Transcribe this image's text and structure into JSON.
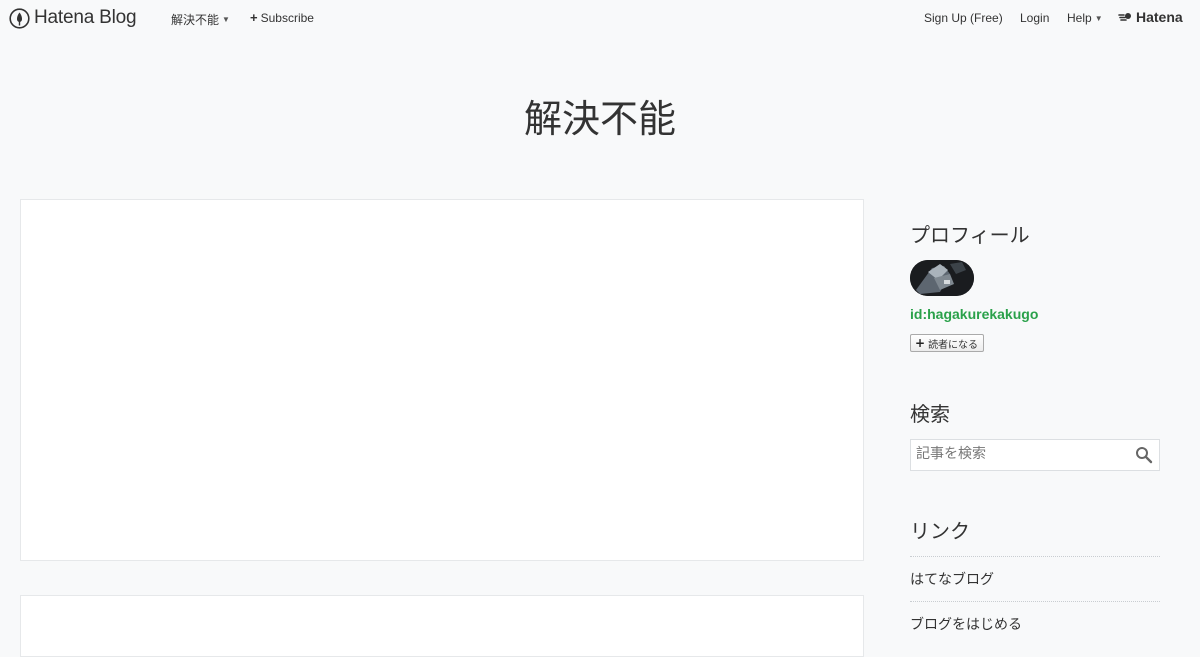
{
  "topbar": {
    "brand_text": "Hatena Blog",
    "blog_menu_label": "解決不能",
    "subscribe_label": "Subscribe",
    "signup_label": "Sign Up (Free)",
    "login_label": "Login",
    "help_label": "Help",
    "hatena_label": "Hatena"
  },
  "blog": {
    "title": "解決不能"
  },
  "sidebar": {
    "profile": {
      "title": "プロフィール",
      "user_id": "id:hagakurekakugo",
      "subscribe_label": "読者になる"
    },
    "search": {
      "title": "検索",
      "placeholder": "記事を検索"
    },
    "links": {
      "title": "リンク",
      "items": [
        {
          "label": "はてなブログ"
        },
        {
          "label": "ブログをはじめる"
        }
      ]
    }
  },
  "colors": {
    "background": "#f8f9fa",
    "accent_green": "#2aa14a",
    "text": "#333333"
  }
}
